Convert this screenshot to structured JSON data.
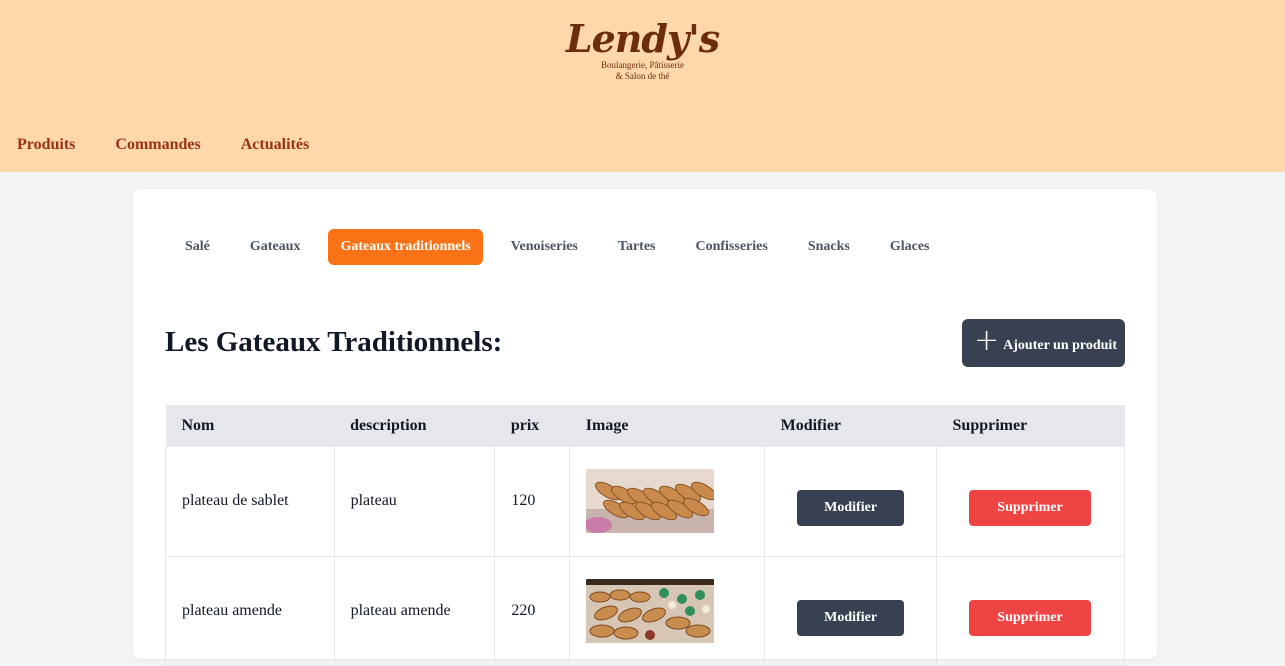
{
  "brand": {
    "name": "Lendy's",
    "tagline_line1": "Boulangerie, Pâtisserie",
    "tagline_line2": "& Salon de thé"
  },
  "nav": [
    "Produits",
    "Commandes",
    "Actualités"
  ],
  "tabs": [
    {
      "label": "Salé",
      "active": false
    },
    {
      "label": "Gateaux",
      "active": false
    },
    {
      "label": "Gateaux traditionnels",
      "active": true
    },
    {
      "label": "Venoiseries",
      "active": false
    },
    {
      "label": "Tartes",
      "active": false
    },
    {
      "label": "Confisseries",
      "active": false
    },
    {
      "label": "Snacks",
      "active": false
    },
    {
      "label": "Glaces",
      "active": false
    }
  ],
  "page_title": "Les Gateaux Traditionnels:",
  "add_button": "Ajouter un produit",
  "table": {
    "headers": [
      "Nom",
      "description",
      "prix",
      "Image",
      "Modifier",
      "Supprimer"
    ],
    "rows": [
      {
        "nom": "plateau de sablet",
        "description": "plateau",
        "prix": "120",
        "modifier": "Modifier",
        "supprimer": "Supprimer"
      },
      {
        "nom": "plateau amende",
        "description": "plateau amende",
        "prix": "220",
        "modifier": "Modifier",
        "supprimer": "Supprimer"
      }
    ]
  },
  "colors": {
    "header_bg": "#fed7aa",
    "nav_text": "#9a3412",
    "active_tab": "#f97316",
    "dark_button": "#374151",
    "delete_button": "#ef4444"
  }
}
